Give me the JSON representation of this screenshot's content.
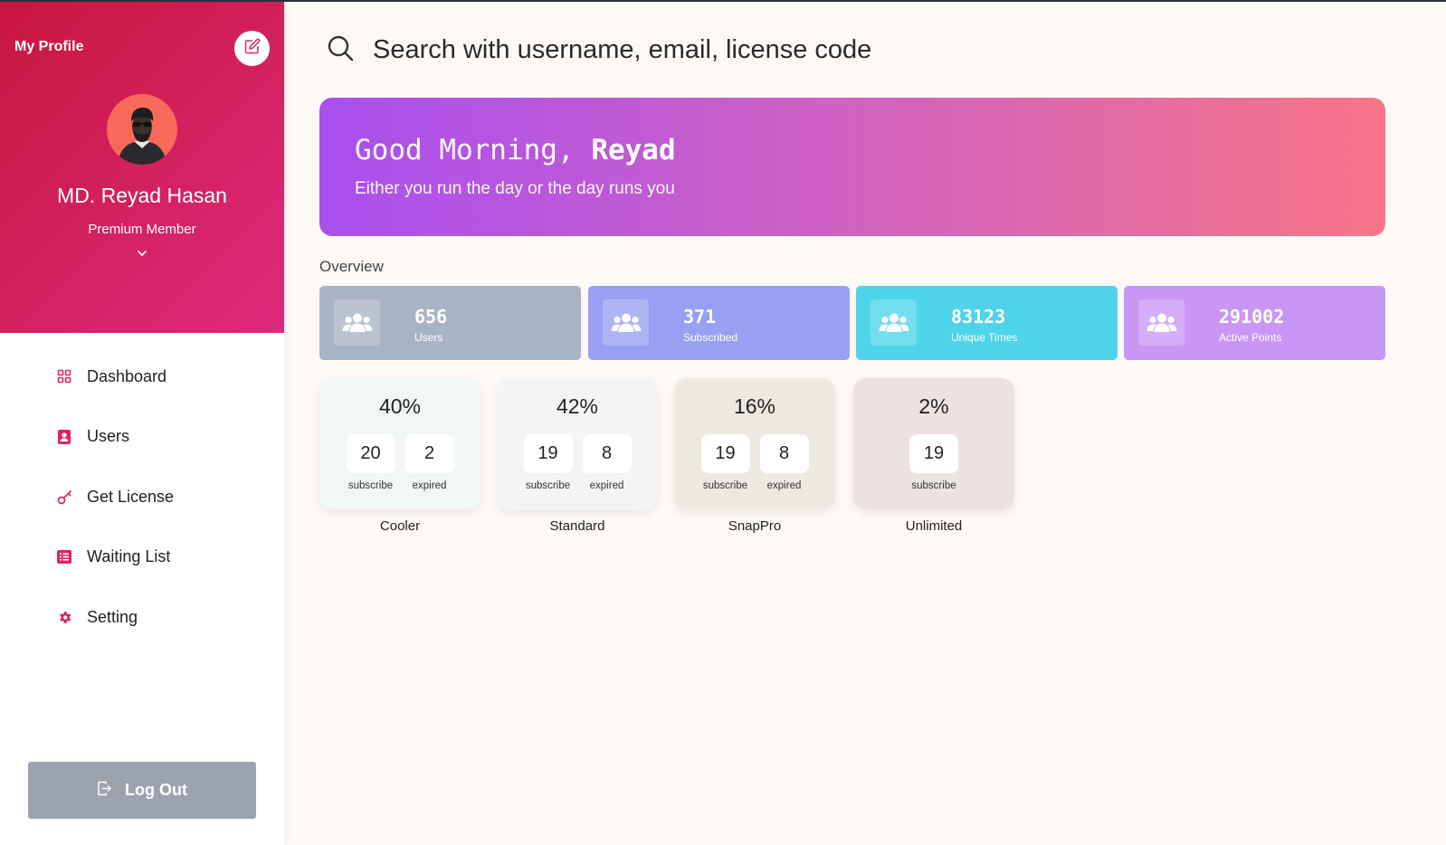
{
  "sidebar": {
    "title": "My Profile",
    "name": "MD. Reyad Hasan",
    "role": "Premium Member",
    "nav": [
      {
        "label": "Dashboard",
        "icon": "grid-icon"
      },
      {
        "label": "Users",
        "icon": "user-badge-icon"
      },
      {
        "label": "Get License",
        "icon": "key-icon"
      },
      {
        "label": "Waiting List",
        "icon": "list-icon"
      },
      {
        "label": "Setting",
        "icon": "gear-icon"
      }
    ],
    "logout_label": "Log Out"
  },
  "search": {
    "placeholder": "Search with username, email, license code"
  },
  "banner": {
    "greeting": "Good Morning,",
    "user": "Reyad",
    "subtitle": "Either you run the day or the day runs you"
  },
  "overview": {
    "title": "Overview",
    "stats": [
      {
        "value": "656",
        "label": "Users",
        "color": "#a8b3c5"
      },
      {
        "value": "371",
        "label": "Subscribed",
        "color": "#97a0f3"
      },
      {
        "value": "83123",
        "label": "Unique Times",
        "color": "#4dd4ea"
      },
      {
        "value": "291002",
        "label": "Active Points",
        "color": "#c996f6"
      }
    ]
  },
  "plans": [
    {
      "name": "Cooler",
      "percent": "40%",
      "subscribe": "20",
      "expired": "2",
      "subscribe_label": "subscribe",
      "expired_label": "expired",
      "bg": "#f1f6f7"
    },
    {
      "name": "Standard",
      "percent": "42%",
      "subscribe": "19",
      "expired": "8",
      "subscribe_label": "subscribe",
      "expired_label": "expired",
      "bg": "#f3f4f5"
    },
    {
      "name": "SnapPro",
      "percent": "16%",
      "subscribe": "19",
      "expired": "8",
      "subscribe_label": "subscribe",
      "expired_label": "expired",
      "bg": "#ede9e1"
    },
    {
      "name": "Unlimited",
      "percent": "2%",
      "subscribe": "19",
      "subscribe_label": "subscribe",
      "bg": "#ece2e1"
    }
  ],
  "colors": {
    "accent": "#e0245e",
    "sidebar_gradient_start": "#c8163f",
    "sidebar_gradient_end": "#dd2a7c",
    "banner_gradient_start": "#a94ff0",
    "banner_gradient_end": "#f87487",
    "logout_bg": "#9ca3af"
  }
}
